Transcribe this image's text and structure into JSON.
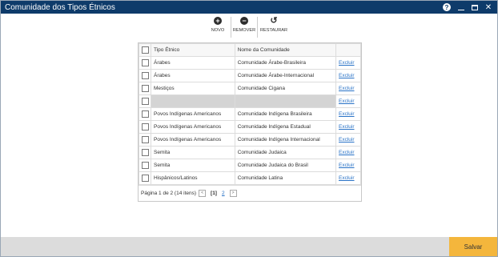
{
  "window": {
    "title": "Comunidade dos Tipos Étnicos"
  },
  "toolbar": {
    "novo": "NOVO",
    "remover": "REMOVER",
    "restaurar": "RESTAURAR"
  },
  "grid": {
    "headers": [
      "Tipo Étnico",
      "Nome da Comunidade"
    ],
    "rows": [
      [
        "Árabes",
        "Comunidade Árabe-Brasileira",
        "Excluir"
      ],
      [
        "Árabes",
        "Comunidade Árabe-Internacional",
        "Excluir"
      ],
      [
        "Mestiços",
        "Comunidade Cigana",
        "Excluir"
      ],
      [
        "",
        "",
        "Excluir"
      ],
      [
        "Povos Indígenas Americanos",
        "Comunidade Indígena Brasileira",
        "Excluir"
      ],
      [
        "Povos Indígenas Americanos",
        "Comunidade Indígena Estadual",
        "Excluir"
      ],
      [
        "Povos Indígenas Americanos",
        "Comunidade Indígena Internacional",
        "Excluir"
      ],
      [
        "Semita",
        "Comunidade Judaica",
        "Excluir"
      ],
      [
        "Semita",
        "Comunidade Judaica do Brasil",
        "Excluir"
      ],
      [
        "Hispânicos/Latinos",
        "Comunidade Latina",
        "Excluir"
      ]
    ]
  },
  "pager": {
    "info": "Página 1 de 2 (14 itens)",
    "prev": "<",
    "page1": "[1]",
    "page2": "2",
    "next": ">"
  },
  "footer": {
    "save": "Salvar"
  },
  "colors": {
    "titlebar": "#0e3b6a",
    "save": "#f4b63c",
    "link": "#2a73c7"
  }
}
